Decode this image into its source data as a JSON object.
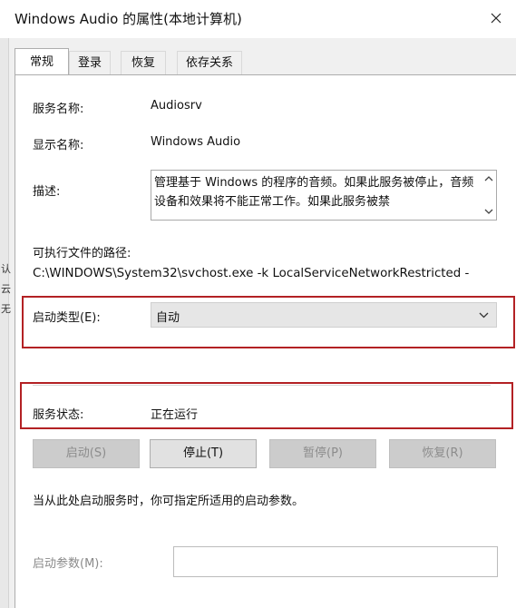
{
  "window": {
    "title": "Windows Audio 的属性(本地计算机)"
  },
  "edge_chars": [
    "认",
    "云",
    "无"
  ],
  "tabs": [
    {
      "label": "常规",
      "active": true
    },
    {
      "label": "登录",
      "active": false
    },
    {
      "label": "恢复",
      "active": false
    },
    {
      "label": "依存关系",
      "active": false
    }
  ],
  "general": {
    "service_name_label": "服务名称:",
    "service_name_value": "Audiosrv",
    "display_name_label": "显示名称:",
    "display_name_value": "Windows Audio",
    "description_label": "描述:",
    "description_value": "管理基于 Windows 的程序的音频。如果此服务被停止，音频设备和效果将不能正常工作。如果此服务被禁",
    "exe_path_label": "可执行文件的路径:",
    "exe_path_value": "C:\\WINDOWS\\System32\\svchost.exe -k LocalServiceNetworkRestricted -",
    "startup_type_label": "启动类型(E):",
    "startup_type_value": "自动",
    "status_label": "服务状态:",
    "status_value": "正在运行",
    "buttons": {
      "start": "启动(S)",
      "stop": "停止(T)",
      "pause": "暂停(P)",
      "resume": "恢复(R)"
    },
    "hint": "当从此处启动服务时，你可指定所适用的启动参数。",
    "params_label": "启动参数(M):",
    "params_value": ""
  },
  "colors": {
    "highlight": "#b32124",
    "panel_bg": "#ffffff",
    "dialog_bg": "#f0f0f0"
  }
}
